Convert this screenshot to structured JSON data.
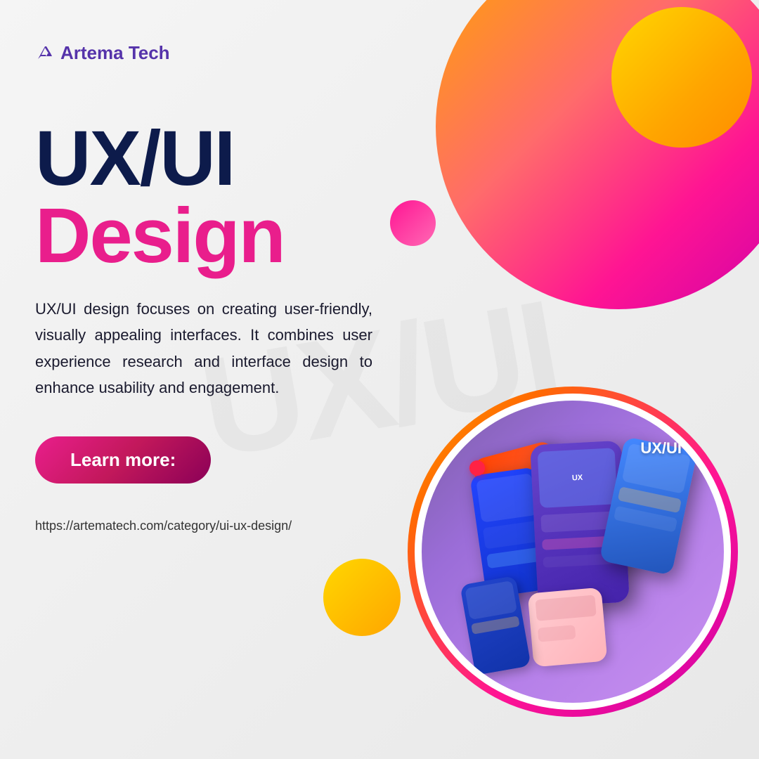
{
  "brand": {
    "logo_text": "Artema Tech",
    "logo_icon": "A"
  },
  "hero": {
    "title_line1": "UX/UI",
    "title_line2": "Design",
    "description": "UX/UI design focuses on creating user-friendly, visually appealing interfaces. It combines user experience research and interface design to enhance usability and engagement.",
    "learn_more_label": "Learn more:",
    "url": "https://artematech.com/category/ui-ux-design/"
  },
  "circle_image": {
    "label": "UX/UI"
  },
  "colors": {
    "accent_pink": "#E91E8C",
    "accent_dark": "#0D1B4B",
    "accent_purple": "#5533AA"
  }
}
